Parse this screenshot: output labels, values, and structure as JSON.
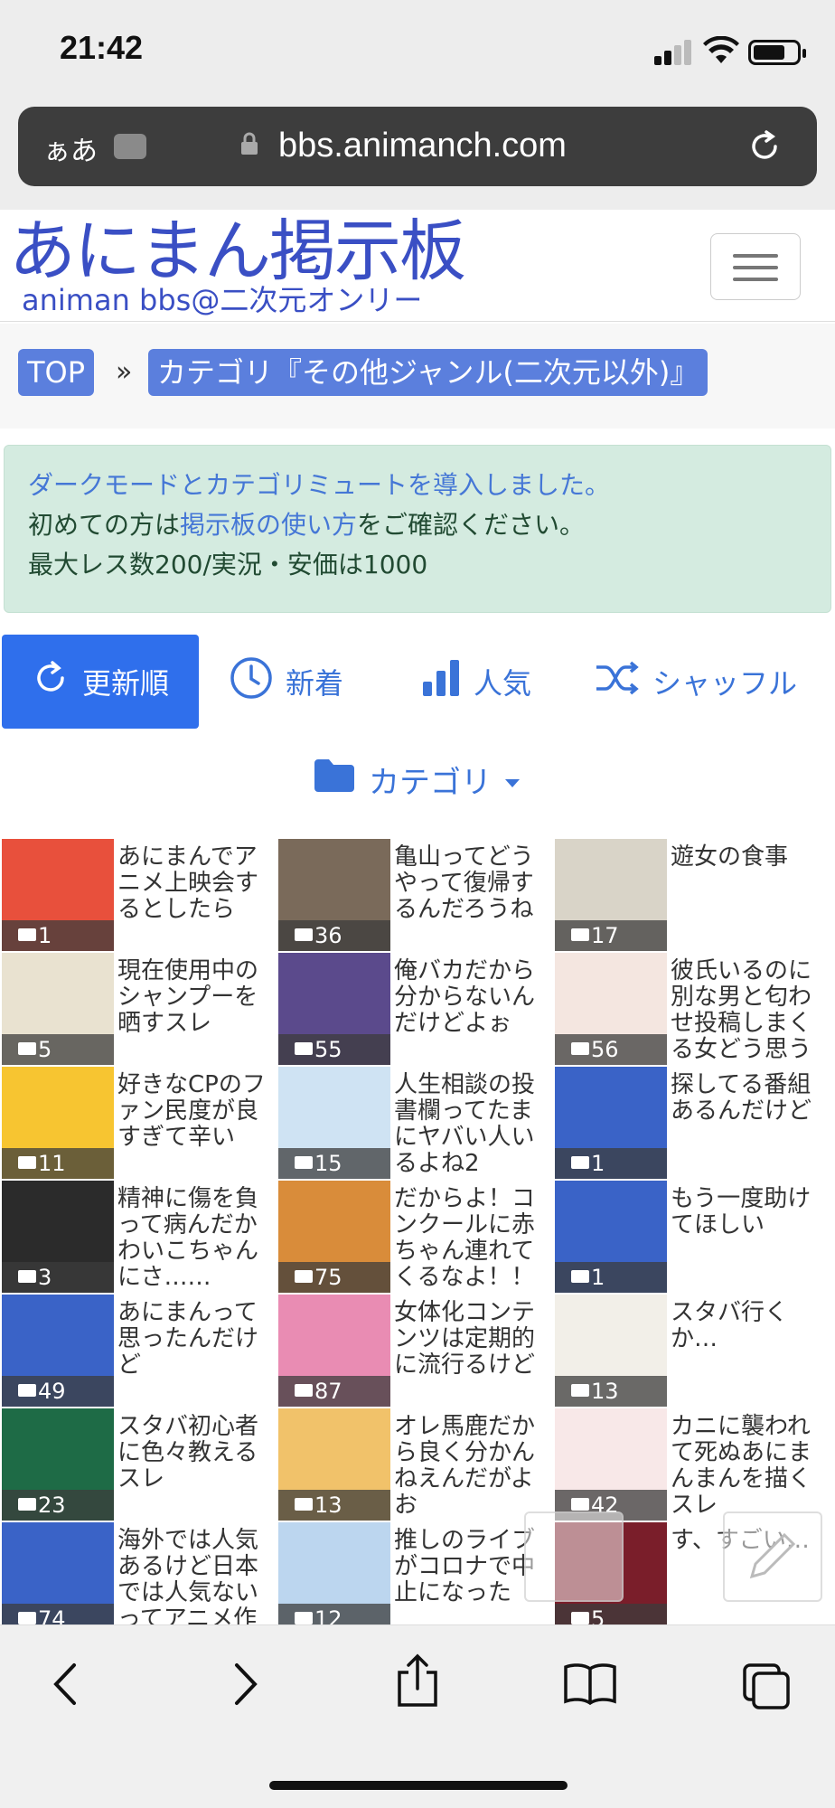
{
  "status": {
    "time": "21:42"
  },
  "browser": {
    "aa_label": "ぁあ",
    "host": "bbs.animanch.com"
  },
  "site": {
    "logo_main": "あにまん掲示板",
    "logo_sub": "animan bbs@二次元オンリー"
  },
  "breadcrumb": {
    "top": "TOP",
    "separator": "»",
    "category": "カテゴリ『その他ジャンル(二次元以外)』"
  },
  "notice": {
    "line1_link": "ダークモードとカテゴリミュートを導入しました。",
    "line2_pre": "初めての方は",
    "line2_link": "掲示板の使い方",
    "line2_post": "をご確認ください。",
    "line3": "最大レス数200/実況・安価は1000"
  },
  "sort_tabs": [
    {
      "label": "更新順",
      "icon": "refresh-icon",
      "active": true
    },
    {
      "label": "新着",
      "icon": "clock-icon",
      "active": false
    },
    {
      "label": "人気",
      "icon": "bar-chart-icon",
      "active": false
    },
    {
      "label": "シャッフル",
      "icon": "shuffle-icon",
      "active": false
    }
  ],
  "category_dropdown": {
    "label": "カテゴリ",
    "icon": "folder-icon"
  },
  "threads": [
    {
      "title": "あにまんでアニメ上映会するとしたら",
      "count": "1",
      "thumb_color": "#e8503c"
    },
    {
      "title": "亀山ってどうやって復帰するんだろうね",
      "count": "36",
      "thumb_color": "#7a6a5a"
    },
    {
      "title": "遊女の食事",
      "count": "17",
      "thumb_color": "#d9d4c8"
    },
    {
      "title": "現在使用中のシャンプーを晒すスレ",
      "count": "5",
      "thumb_color": "#e9e2d0"
    },
    {
      "title": "俺バカだから分からないんだけどよぉ",
      "count": "55",
      "thumb_color": "#5b4a8c"
    },
    {
      "title": "彼氏いるのに別な男と匂わせ投稿しまくる女どう思う",
      "count": "56",
      "thumb_color": "#f4e6e0"
    },
    {
      "title": "好きなCPのファン民度が良すぎて辛い",
      "count": "11",
      "thumb_color": "#f7c531"
    },
    {
      "title": "人生相談の投書欄ってたまにヤバい人いるよね2",
      "count": "15",
      "thumb_color": "#cfe3f3"
    },
    {
      "title": "探してる番組あるんだけど",
      "count": "1",
      "thumb_color": "#3a63c7"
    },
    {
      "title": "精神に傷を負って病んだかわいこちゃんにさ……",
      "count": "3",
      "thumb_color": "#2b2b2b"
    },
    {
      "title": "だからよ！コンクールに赤ちゃん連れてくるなよ！！",
      "count": "75",
      "thumb_color": "#d98c3a"
    },
    {
      "title": "もう一度助けてほしい",
      "count": "1",
      "thumb_color": "#3a63c7"
    },
    {
      "title": "あにまんって思ったんだけど",
      "count": "49",
      "thumb_color": "#3a63c7"
    },
    {
      "title": "女体化コンテンツは定期的に流行るけど",
      "count": "87",
      "thumb_color": "#e98cb3"
    },
    {
      "title": "スタバ行くか…",
      "count": "13",
      "thumb_color": "#f2efe8"
    },
    {
      "title": "スタバ初心者に色々教えるスレ",
      "count": "23",
      "thumb_color": "#1e6b46"
    },
    {
      "title": "オレ馬鹿だから良く分かんねえんだがよお",
      "count": "13",
      "thumb_color": "#f1c26a"
    },
    {
      "title": "カニに襲われて死ぬあにまんまんを描くスレ",
      "count": "42",
      "thumb_color": "#f8e8e8"
    },
    {
      "title": "海外では人気あるけど日本では人気ないってアニメ作",
      "count": "74",
      "thumb_color": "#3a63c7"
    },
    {
      "title": "推しのライブがコロナで中止になった",
      "count": "12",
      "thumb_color": "#bcd6ef"
    },
    {
      "title": "す、すごい…",
      "count": "5",
      "thumb_color": "#7a1e2a"
    }
  ],
  "bottom_nav": [
    {
      "icon": "back-icon"
    },
    {
      "icon": "forward-icon"
    },
    {
      "icon": "share-icon"
    },
    {
      "icon": "bookmarks-icon"
    },
    {
      "icon": "tabs-icon"
    }
  ]
}
